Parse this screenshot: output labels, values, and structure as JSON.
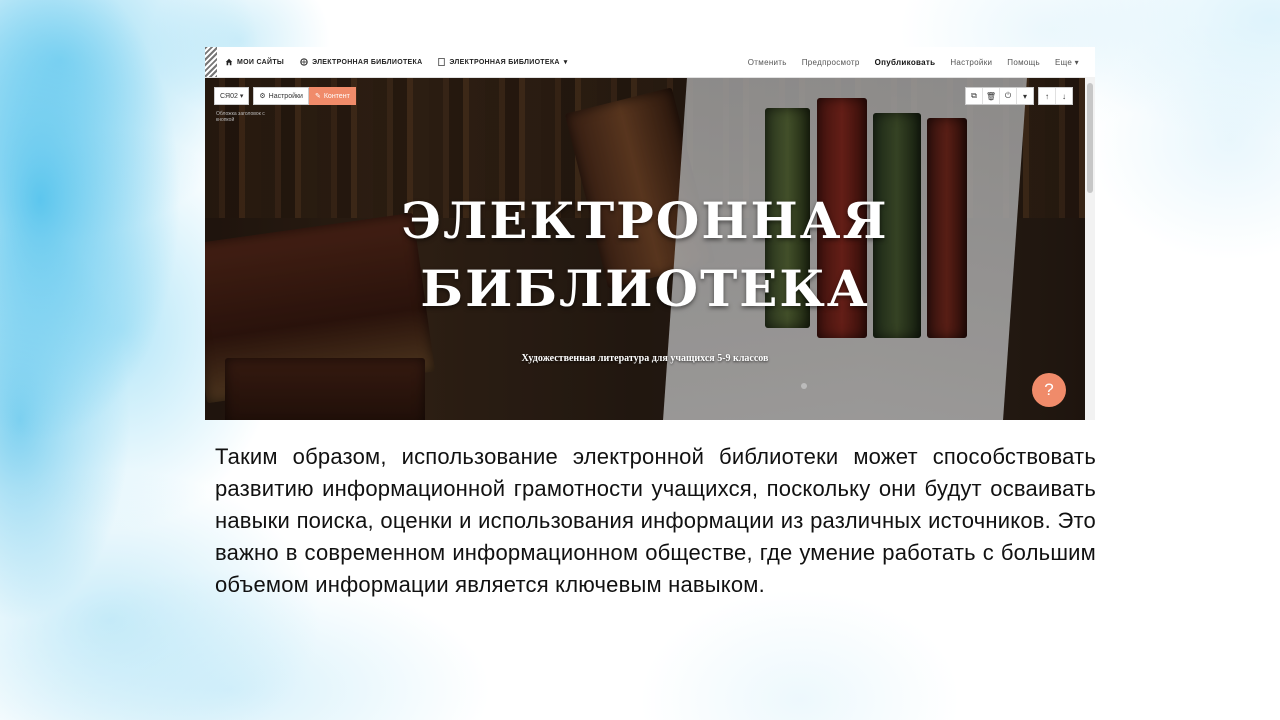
{
  "topbar": {
    "nav": {
      "my_sites": "МОИ САЙТЫ",
      "site_name": "ЭЛЕКТРОННАЯ БИБЛИОТЕКА",
      "page_name": "ЭЛЕКТРОННАЯ БИБЛИОТЕКА"
    },
    "actions": {
      "cancel": "Отменить",
      "preview": "Предпросмотр",
      "publish": "Опубликовать",
      "settings": "Настройки",
      "help": "Помощь",
      "more": "Еще ▾"
    }
  },
  "editor_toolbar": {
    "section_select": "СЯ02 ▾",
    "settings_label": "Настройки",
    "content_label": "Контент",
    "section_note": "Обложка заголовок с кнопкой"
  },
  "hero": {
    "title_line1": "ЭЛЕКТРОННАЯ",
    "title_line2": "БИБЛИОТЕКА",
    "subtitle": "Художественная литература для учащихся 5-9 классов",
    "help_button": "?"
  },
  "paragraph": "Таким образом,   использование электронной библиотеки может способствовать развитию информационной грамотности учащихся, поскольку они будут осваивать навыки поиска, оценки и использования информации из различных источников. Это важно в современном информационном обществе, где умение работать с большим объемом информации является ключевым навыком.",
  "colors": {
    "accent": "#f08b6a",
    "background_wash": "#46bee b",
    "text": "#111111"
  }
}
